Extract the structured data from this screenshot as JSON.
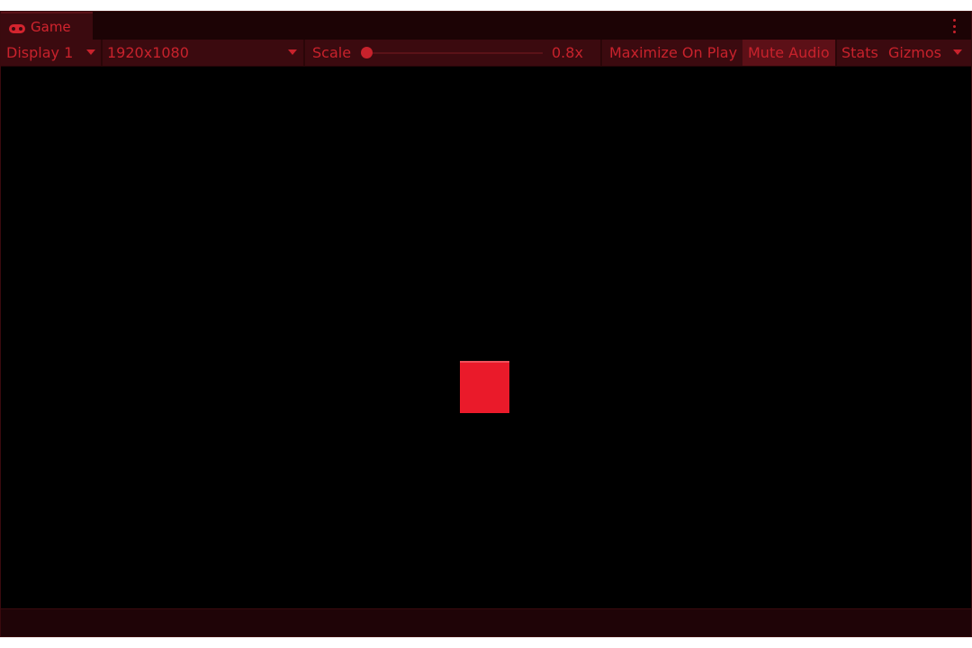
{
  "tab": {
    "title": "Game",
    "icon": "gamepad-icon"
  },
  "toolbar": {
    "display": "Display 1",
    "resolution": "1920x1080",
    "scale_label": "Scale",
    "scale_value": "0.8x",
    "scale_fraction": 0.0,
    "maximize_on_play": "Maximize On Play",
    "mute_audio": "Mute Audio",
    "stats": "Stats",
    "gizmos": "Gizmos"
  },
  "colors": {
    "accent": "#c8222c",
    "panel": "#3b0a0f",
    "viewport_bg": "#000000",
    "cube": "#ea1a2a"
  }
}
